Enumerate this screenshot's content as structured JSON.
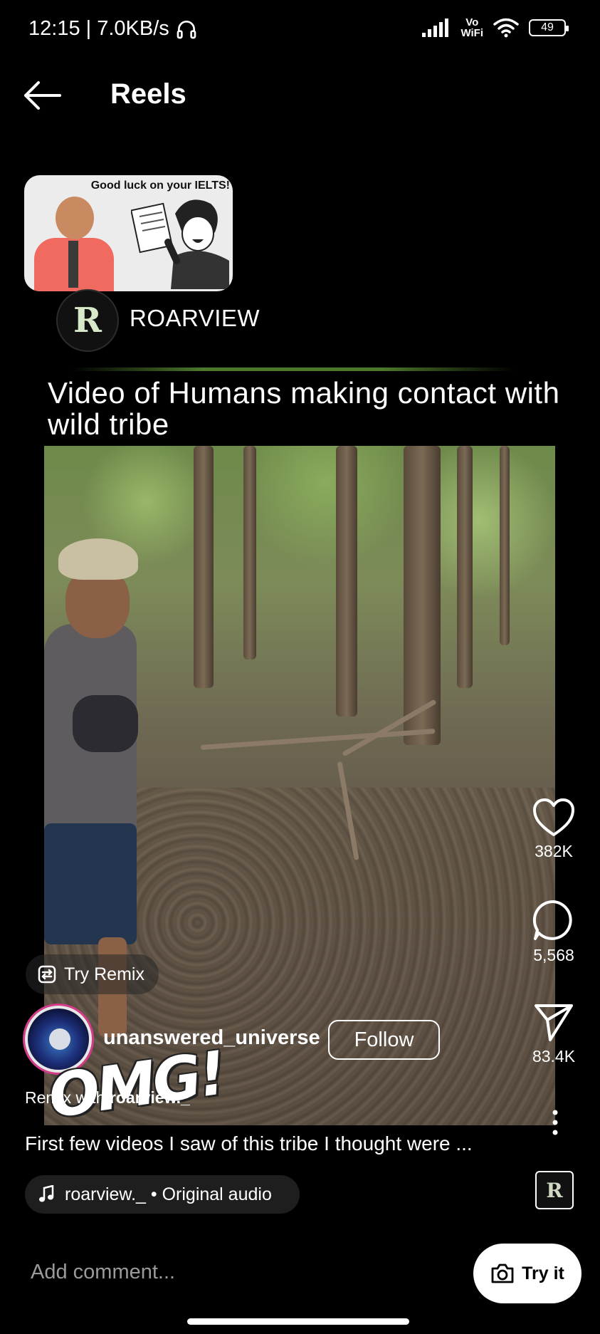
{
  "status_bar": {
    "time_speed": "12:15 | 7.0KB/s",
    "network_label_top": "Vo",
    "network_label_bottom": "WiFi",
    "battery": "49"
  },
  "header": {
    "title": "Reels"
  },
  "mini_player": {
    "caption": "Good luck on your IELTS!"
  },
  "channel": {
    "name": "ROARVIEW",
    "logo_letter": "R"
  },
  "video": {
    "title": "Video of Humans making contact with wild tribe",
    "sticker_text": "OMG!"
  },
  "actions": {
    "likes": "382K",
    "comments": "5,568",
    "shares": "83.4K"
  },
  "remix": {
    "label": "Try Remix",
    "remix_with_prefix": "Remix with ",
    "remix_with_user": "roarview._"
  },
  "post": {
    "username": "unanswered_universe",
    "follow_label": "Follow",
    "caption": "First few videos I saw of this tribe I thought were ..."
  },
  "audio": {
    "label": "roarview._ • Original audio"
  },
  "comment_bar": {
    "placeholder": "Add comment...",
    "try_it_label": "Try it"
  }
}
